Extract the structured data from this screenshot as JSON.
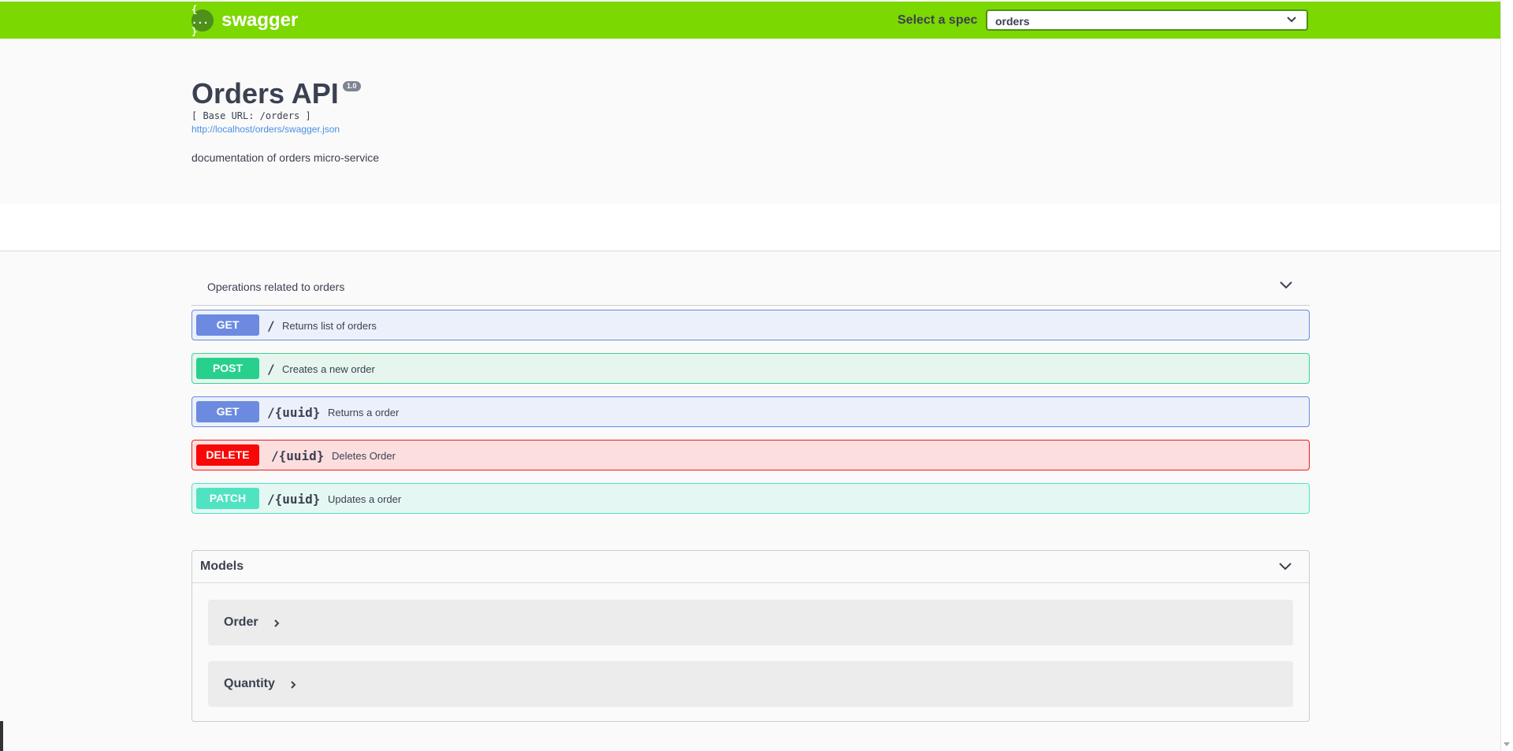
{
  "topbar": {
    "brand_icon": "{ ... }",
    "brand_name": "swagger",
    "spec_label": "Select a spec",
    "spec_value": "orders",
    "bar_color": "#7bd800"
  },
  "info": {
    "title": "Orders API",
    "version": "1.0",
    "base_url": "[ Base URL: /orders ]",
    "spec_link": "http://localhost/orders/swagger.json",
    "description": "documentation of orders micro-service"
  },
  "tag": {
    "description": "Operations related to orders"
  },
  "operations": [
    {
      "method": "GET",
      "path": "/",
      "summary": "Returns list of orders"
    },
    {
      "method": "POST",
      "path": "/",
      "summary": "Creates a new order"
    },
    {
      "method": "GET",
      "path": "/{uuid}",
      "summary": "Returns a order"
    },
    {
      "method": "DELETE",
      "path": "/{uuid}",
      "summary": "Deletes Order"
    },
    {
      "method": "PATCH",
      "path": "/{uuid}",
      "summary": "Updates a order"
    }
  ],
  "models": {
    "title": "Models",
    "items": [
      {
        "name": "Order"
      },
      {
        "name": "Quantity"
      }
    ]
  },
  "colors": {
    "get": "#6b8ae0",
    "post": "#27d08c",
    "delete": "#f90707",
    "patch": "#50e3c2"
  },
  "icons": {
    "spec_caret": "chevron-down-icon",
    "tag_toggle": "chevron-down-icon",
    "models_toggle": "chevron-down-icon",
    "model_expand": "chevron-right-icon"
  }
}
